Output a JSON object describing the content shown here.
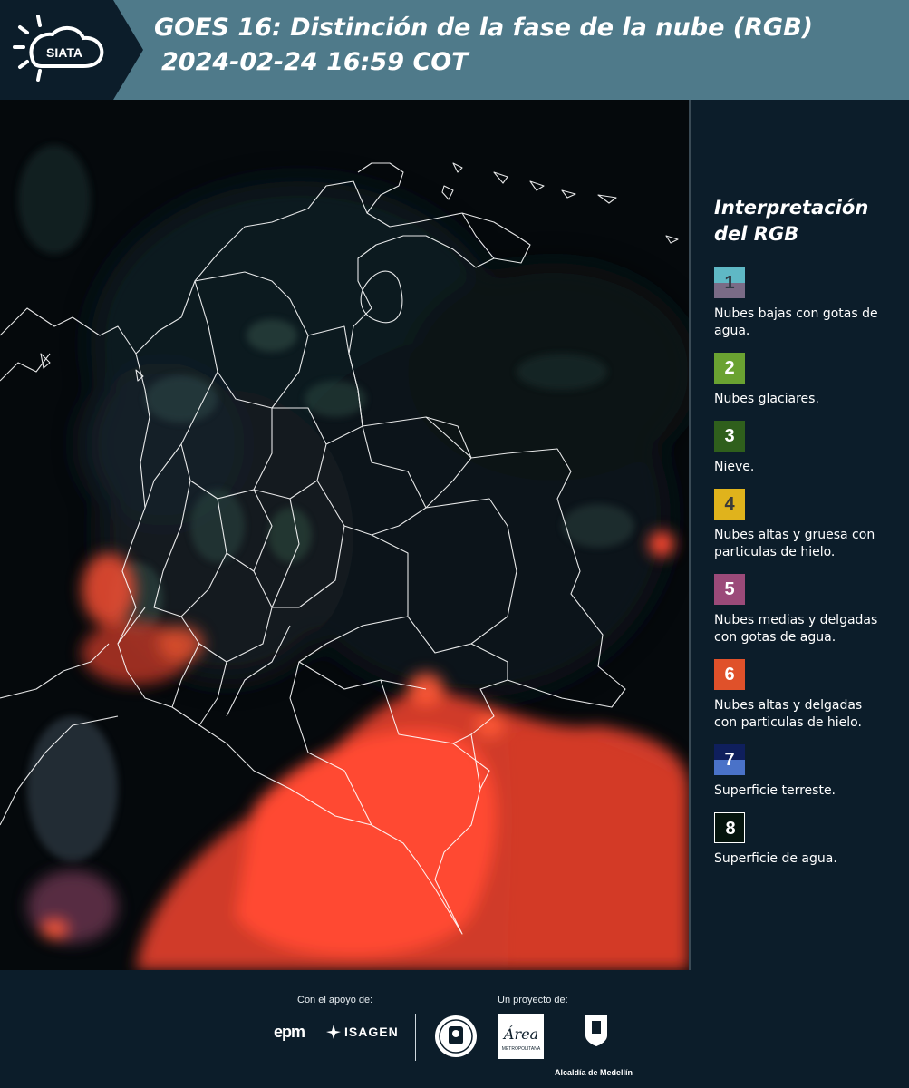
{
  "header": {
    "logo_text": "SIATA",
    "title_line1": "GOES 16: Distinción de la fase de la nube (RGB)",
    "title_line2": "2024-02-24 16:59 COT"
  },
  "legend": {
    "title_line1": "Interpretación",
    "title_line2": "del RGB",
    "items": [
      {
        "num": "1",
        "label": "Nubes bajas con gotas de agua.",
        "top_color": "#5fb8c5",
        "bottom_color": "#7a6b86",
        "num_color": "#2f3a44"
      },
      {
        "num": "2",
        "label": "Nubes glaciares.",
        "top_color": "#6aa231",
        "bottom_color": "#6aa231",
        "num_color": "#ffffff"
      },
      {
        "num": "3",
        "label": "Nieve.",
        "top_color": "#2f5f1c",
        "bottom_color": "#2f5f1c",
        "num_color": "#ffffff"
      },
      {
        "num": "4",
        "label": "Nubes altas y gruesa con particulas de hielo.",
        "top_color": "#e0b31c",
        "bottom_color": "#e0b31c",
        "num_color": "#3a3a3a"
      },
      {
        "num": "5",
        "label": "Nubes medias y delgadas con gotas de agua.",
        "top_color": "#9b4a79",
        "bottom_color": "#9b4a79",
        "num_color": "#ffffff"
      },
      {
        "num": "6",
        "label": "Nubes altas y delgadas con particulas de hielo.",
        "top_color": "#e0512a",
        "bottom_color": "#e0512a",
        "num_color": "#ffffff"
      },
      {
        "num": "7",
        "label": "Superficie terreste.",
        "top_color": "#0f1f5c",
        "bottom_color": "#4a72c8",
        "num_color": "#ffffff"
      },
      {
        "num": "8",
        "label": "Superficie de agua.",
        "top_color": "#05140d",
        "bottom_color": "#05140d",
        "num_color": "#ffffff"
      }
    ]
  },
  "footer": {
    "support_label": "Con el apoyo de:",
    "project_label": "Un proyecto de:",
    "epm_text": "epm",
    "isagen_text": "ISAGEN",
    "metro_text": "Área",
    "metro_sub": "METROPOLITANA",
    "alcaldia_text": "Alcaldía de Medellín"
  },
  "colors": {
    "header_bg": "#4f7a8a",
    "page_bg": "#0c1d2a",
    "cloud_red": "#f0452c",
    "map_bg": "#05090c"
  },
  "icons": [
    "siata-sun-cloud-icon",
    "epm-logo-icon",
    "isagen-logo-icon",
    "university-seal-icon",
    "area-metropolitana-logo-icon",
    "alcaldia-medellin-shield-icon"
  ]
}
